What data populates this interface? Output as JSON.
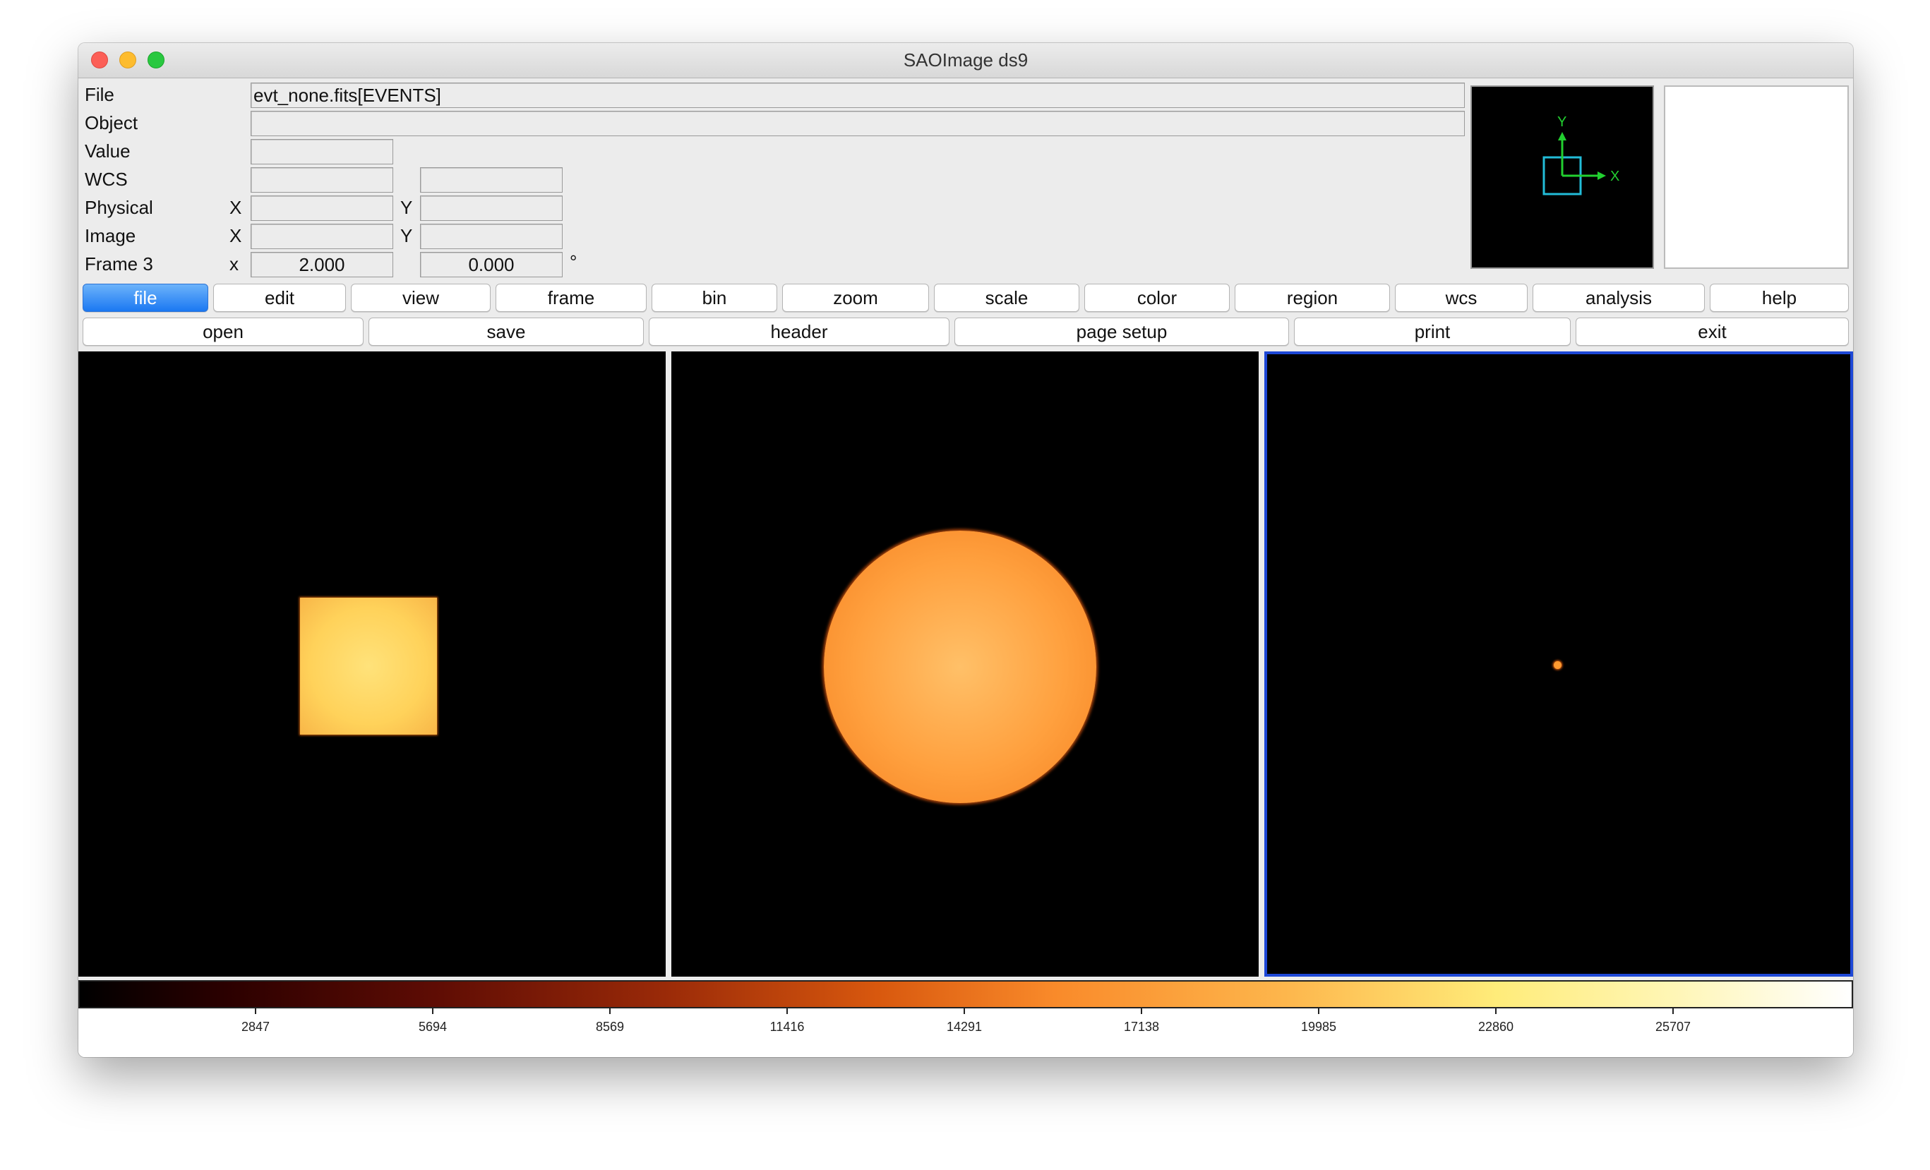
{
  "window": {
    "title": "SAOImage ds9",
    "accent_color": "#1d47d6",
    "active_button_color": "#1b78f2"
  },
  "info": {
    "file_label": "File",
    "file_value": "evt_none.fits[EVENTS]",
    "object_label": "Object",
    "object_value": "",
    "value_label": "Value",
    "value_value": "",
    "wcs_label": "WCS",
    "physical_label": "Physical",
    "image_label": "Image",
    "frame_label": "Frame 3",
    "x_label_upper": "X",
    "y_label_upper": "Y",
    "x_label_lower": "x",
    "zoom_value": "2.000",
    "angle_value": "0.000",
    "degree_symbol": "°"
  },
  "magnifier": {
    "y_axis": "Y",
    "x_axis": "X"
  },
  "menu": {
    "items": [
      "file",
      "edit",
      "view",
      "frame",
      "bin",
      "zoom",
      "scale",
      "color",
      "region",
      "wcs",
      "analysis",
      "help"
    ],
    "active": "file"
  },
  "file_buttons": {
    "items": [
      "open",
      "save",
      "header",
      "page setup",
      "print",
      "exit"
    ]
  },
  "frames": {
    "current": 3,
    "shapes": [
      "square",
      "circle",
      "point"
    ]
  },
  "colorbar": {
    "colormap_note": "heat",
    "ticks": [
      "2847",
      "5694",
      "8569",
      "11416",
      "14291",
      "17138",
      "19985",
      "22860",
      "25707"
    ]
  }
}
